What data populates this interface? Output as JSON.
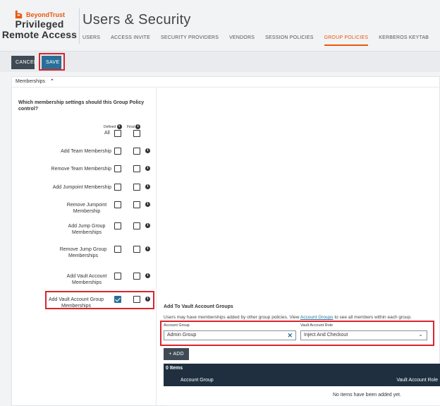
{
  "brand": {
    "name": "BeyondTrust",
    "line1": "Privileged",
    "line2": "Remote Access",
    "color": "#e8590c"
  },
  "page": {
    "title": "Users & Security"
  },
  "tabs": [
    {
      "label": "USERS",
      "active": false
    },
    {
      "label": "ACCESS INVITE",
      "active": false
    },
    {
      "label": "SECURITY PROVIDERS",
      "active": false
    },
    {
      "label": "VENDORS",
      "active": false
    },
    {
      "label": "SESSION POLICIES",
      "active": false
    },
    {
      "label": "GROUP POLICIES",
      "active": true
    },
    {
      "label": "KERBEROS KEYTAB",
      "active": false
    }
  ],
  "toolbar": {
    "cancel_label": "CANCEL",
    "save_label": "SAVE"
  },
  "section": {
    "title": "Memberships",
    "chevron_icon": "chevron-up-icon"
  },
  "memberships": {
    "question": "Which membership settings should this Group Policy control?",
    "defined_header": "Defined",
    "final_header": "Final",
    "all_label": "All",
    "rows": [
      {
        "label": "Add Team Membership",
        "defined": false,
        "final": false
      },
      {
        "label": "Remove Team Membership",
        "defined": false,
        "final": false
      },
      {
        "label": "Add Jumpoint Membership",
        "defined": false,
        "final": false
      },
      {
        "label": "Remove Jumpoint Membership",
        "defined": false,
        "final": false
      },
      {
        "label": "Add Jump Group Memberships",
        "defined": false,
        "final": false
      },
      {
        "label": "Remove Jump Group Memberships",
        "defined": false,
        "final": false
      },
      {
        "label": "Add Vault Account Memberships",
        "defined": false,
        "final": false
      },
      {
        "label": "Add Vault Account Group Memberships",
        "defined": true,
        "final": false
      }
    ]
  },
  "vault": {
    "title": "Add To Vault Account Groups",
    "desc_before": "Users may have memberships added by other group policies. View ",
    "desc_link": "Account Groups",
    "desc_after": " to see all members within each group.",
    "account_group_label": "Account Group",
    "account_group_value": "Admin Group",
    "role_label": "Vault Account Role",
    "role_value": "Inject And Checkout",
    "add_label": "+ ADD",
    "items_count": "0 Items",
    "col_account_group": "Account Group",
    "col_role": "Vault Account Role",
    "empty_message": "No items have been added yet."
  },
  "colors": {
    "accent": "#e8590c",
    "primary": "#2a6f97",
    "dark": "#1f2f3f",
    "highlight": "#d9262e"
  }
}
